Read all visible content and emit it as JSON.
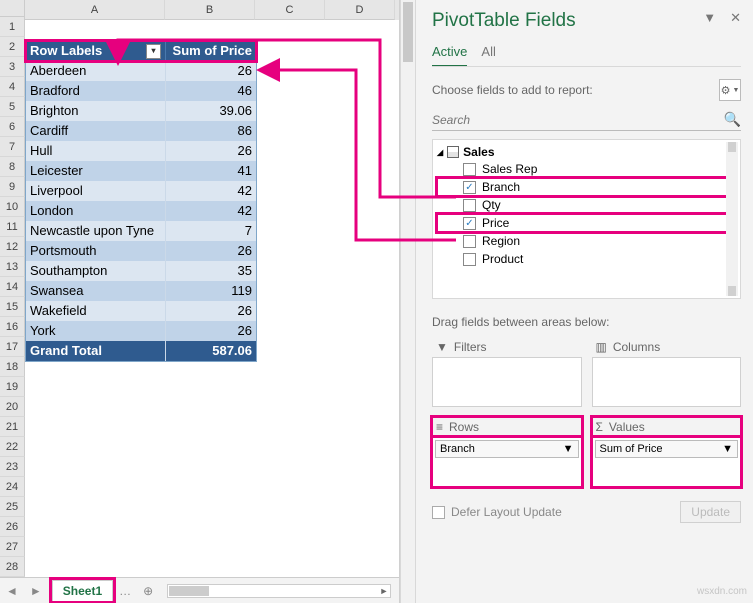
{
  "sheet": {
    "col_labels": [
      "A",
      "B",
      "C",
      "D"
    ],
    "rows": 28,
    "active_tab": "Sheet1"
  },
  "pivot": {
    "header_row_labels": "Row Labels",
    "header_sum": "Sum of Price",
    "rows": [
      {
        "label": "Aberdeen",
        "val": "26"
      },
      {
        "label": "Bradford",
        "val": "46"
      },
      {
        "label": "Brighton",
        "val": "39.06"
      },
      {
        "label": "Cardiff",
        "val": "86"
      },
      {
        "label": "Hull",
        "val": "26"
      },
      {
        "label": "Leicester",
        "val": "41"
      },
      {
        "label": "Liverpool",
        "val": "42"
      },
      {
        "label": "London",
        "val": "42"
      },
      {
        "label": "Newcastle upon Tyne",
        "val": "7"
      },
      {
        "label": "Portsmouth",
        "val": "26"
      },
      {
        "label": "Southampton",
        "val": "35"
      },
      {
        "label": "Swansea",
        "val": "119"
      },
      {
        "label": "Wakefield",
        "val": "26"
      },
      {
        "label": "York",
        "val": "26"
      }
    ],
    "total_label": "Grand Total",
    "total_val": "587.06"
  },
  "pane": {
    "title": "PivotTable Fields",
    "tab_active": "Active",
    "tab_all": "All",
    "choose": "Choose fields to add to report:",
    "search_placeholder": "Search",
    "table_name": "Sales",
    "fields": [
      {
        "name": "Sales Rep",
        "checked": false,
        "hl": false
      },
      {
        "name": "Branch",
        "checked": true,
        "hl": true
      },
      {
        "name": "Qty",
        "checked": false,
        "hl": false
      },
      {
        "name": "Price",
        "checked": true,
        "hl": true
      },
      {
        "name": "Region",
        "checked": false,
        "hl": false
      },
      {
        "name": "Product",
        "checked": false,
        "hl": false
      }
    ],
    "drag_label": "Drag fields between areas below:",
    "area_filters": "Filters",
    "area_columns": "Columns",
    "area_rows": "Rows",
    "area_values": "Values",
    "rows_pill": "Branch",
    "values_pill": "Sum of Price",
    "defer": "Defer Layout Update",
    "update": "Update"
  },
  "watermark": "wsxdn.com"
}
